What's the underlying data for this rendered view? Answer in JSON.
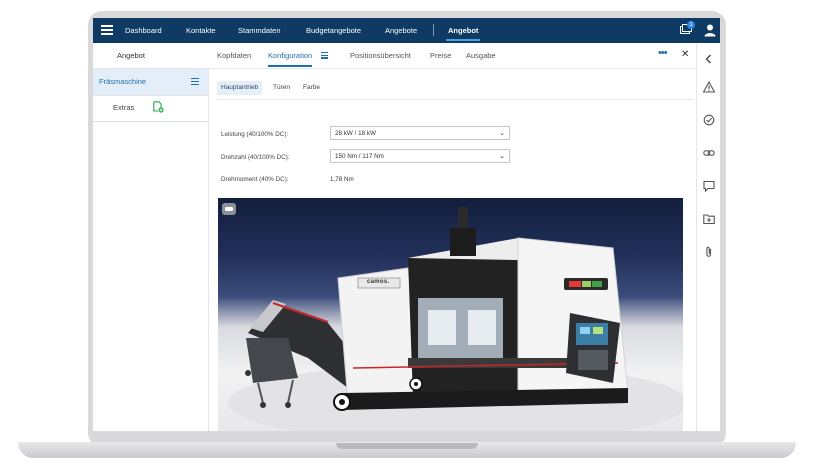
{
  "nav": {
    "items": [
      "Dashboard",
      "Kontakte",
      "Stammdaten",
      "Budgetangebote",
      "Angebote",
      "Angebot"
    ],
    "notification_count": "1"
  },
  "subheader": {
    "title": "Angebot",
    "tabs": [
      "Kopfdaten",
      "Konfiguration",
      "Positionsübersicht",
      "Preise",
      "Ausgabe"
    ],
    "active_tab": "Konfiguration"
  },
  "sidebar": {
    "items": [
      {
        "label": "Fräsmaschine"
      },
      {
        "label": "Extras"
      }
    ]
  },
  "config": {
    "subtabs": [
      "Hauptantrieb",
      "Türen",
      "Farbe"
    ],
    "active_subtab": "Hauptantrieb",
    "fields": [
      {
        "label": "Leistung (40/100% DC):",
        "value": "28 kW / 18 kW"
      },
      {
        "label": "Drehzahl (40/100% DC):",
        "value": "150 Nm / 117 Nm"
      },
      {
        "label": "Drehmoment (40% DC):",
        "value": "1,78 Nm"
      }
    ]
  },
  "viewer": {
    "machine_brand": "camos."
  },
  "colors": {
    "navbar": "#0e3a63",
    "accent": "#1f6fb2",
    "sidebar_active_bg": "#e4eef8",
    "add_icon": "#2aa84a"
  }
}
